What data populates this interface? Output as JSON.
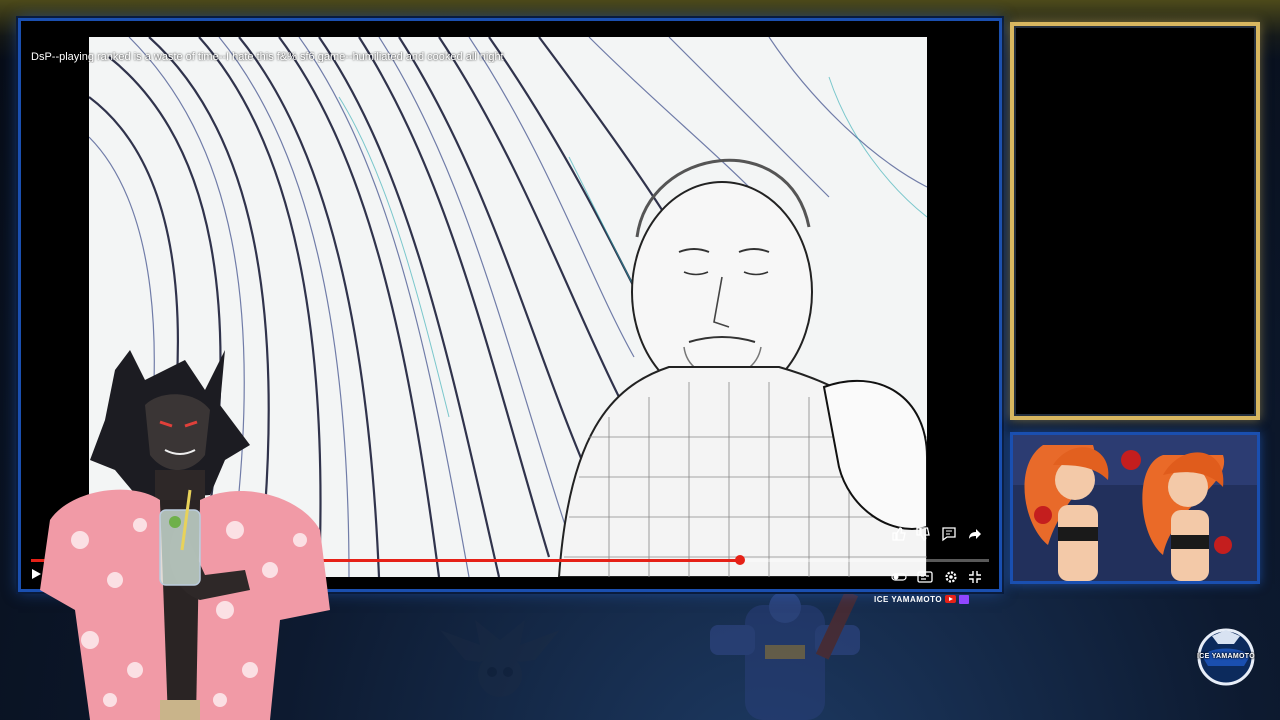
{
  "video": {
    "title": "DsP--playing ranked is a waste of time--I hate this f&% sf6 game--humiliated and cooked all night",
    "progress": 0.74,
    "icons": [
      "play-icon",
      "like-icon",
      "dislike-icon",
      "comment-icon",
      "share-icon",
      "settings-icon",
      "captions-icon",
      "fullscreen-exit-icon",
      "autoplay-icon"
    ]
  },
  "branding": {
    "channel_name": "ICE YAMAMOTO",
    "logo_text": "ICE YAMAMOTO"
  },
  "colors": {
    "frame_blue": "#1a4fb0",
    "cam_gold": "#d8b760",
    "progress_red": "#e62117",
    "background_navy": "#0d1a30"
  }
}
